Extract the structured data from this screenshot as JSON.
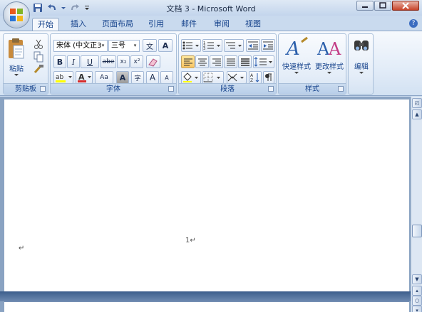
{
  "window": {
    "title": "文档 3 - Microsoft Word"
  },
  "tabs": [
    {
      "label": "开始"
    },
    {
      "label": "插入"
    },
    {
      "label": "页面布局"
    },
    {
      "label": "引用"
    },
    {
      "label": "邮件"
    },
    {
      "label": "审阅"
    },
    {
      "label": "视图"
    }
  ],
  "ribbon": {
    "clipboard": {
      "label": "剪贴板",
      "paste": "粘贴"
    },
    "font": {
      "label": "字体",
      "font_name": "宋体 (中文正3",
      "font_size": "三号",
      "bold": "B",
      "italic": "I",
      "underline": "U",
      "strike": "abe",
      "subscript": "x₂",
      "superscript": "x²",
      "font_color": "A",
      "change_case": "Aa",
      "grow": "A",
      "shrink": "A",
      "char_shading": "A",
      "enclose": "字",
      "phonetic": "文",
      "border": "A"
    },
    "paragraph": {
      "label": "段落"
    },
    "styles": {
      "label": "样式",
      "quick_styles": "快速样式",
      "change_styles": "更改样式"
    },
    "editing": {
      "label": "编辑"
    }
  },
  "document": {
    "page_number_mark": "1↵",
    "paragraph_mark": "↵"
  },
  "colors": {
    "accent": "#15428b",
    "highlight": "#f9c463"
  }
}
